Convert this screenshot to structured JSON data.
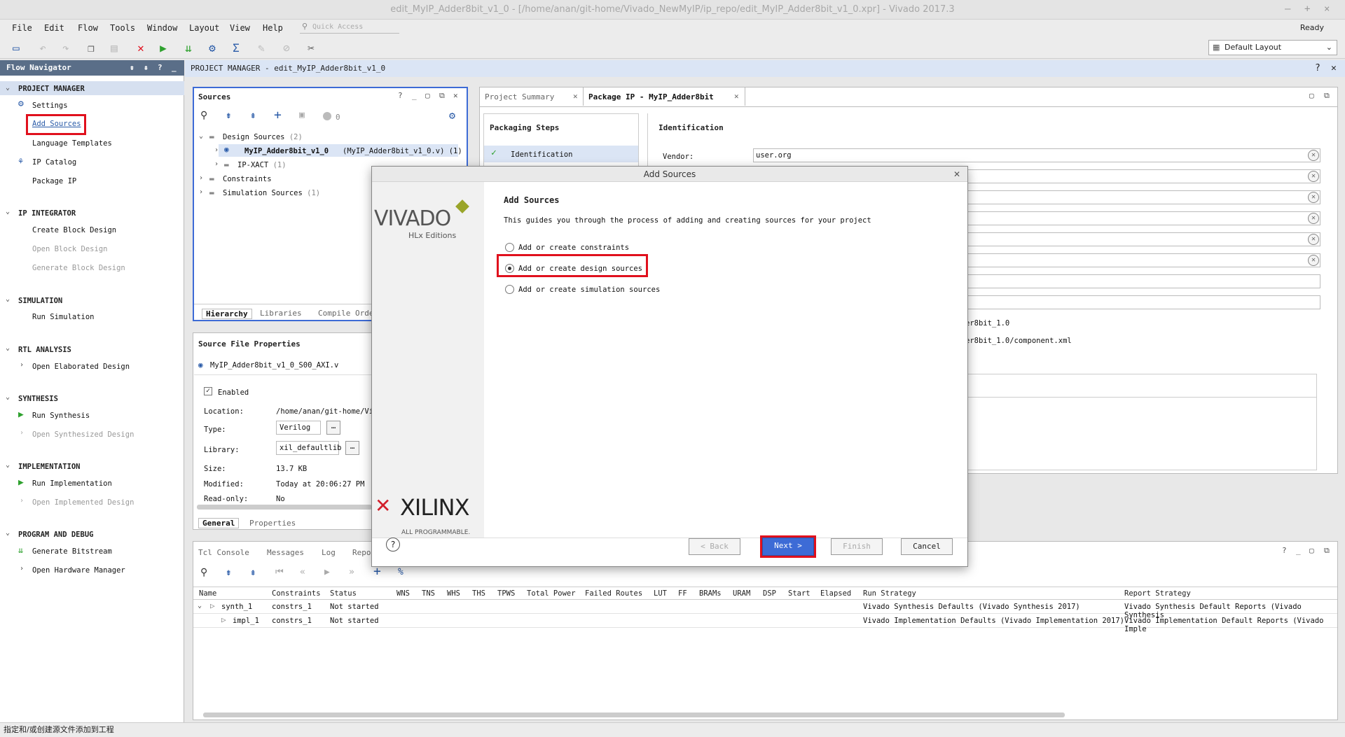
{
  "window": {
    "title": "edit_MyIP_Adder8bit_v1_0 - [/home/anan/git-home/Vivado_NewMyIP/ip_repo/edit_MyIP_Adder8bit_v1_0.xpr] - Vivado 2017.3",
    "status": "Ready"
  },
  "menu": [
    "File",
    "Edit",
    "Flow",
    "Tools",
    "Window",
    "Layout",
    "View",
    "Help"
  ],
  "quick_access_placeholder": "Quick Access",
  "layout_selector": "Default Layout",
  "flow_navigator": {
    "title": "Flow Navigator",
    "sections": {
      "project_manager": "PROJECT MANAGER",
      "settings": "Settings",
      "add_sources": "Add Sources",
      "language_templates": "Language Templates",
      "ip_catalog": "IP Catalog",
      "package_ip": "Package IP",
      "ip_integrator": "IP INTEGRATOR",
      "create_block_design": "Create Block Design",
      "open_block_design": "Open Block Design",
      "generate_block_design": "Generate Block Design",
      "simulation": "SIMULATION",
      "run_simulation": "Run Simulation",
      "rtl_analysis": "RTL ANALYSIS",
      "open_elaborated_design": "Open Elaborated Design",
      "synthesis": "SYNTHESIS",
      "run_synthesis": "Run Synthesis",
      "open_synthesized_design": "Open Synthesized Design",
      "implementation": "IMPLEMENTATION",
      "run_implementation": "Run Implementation",
      "open_implemented_design": "Open Implemented Design",
      "program_and_debug": "PROGRAM AND DEBUG",
      "generate_bitstream": "Generate Bitstream",
      "open_hardware_manager": "Open Hardware Manager"
    }
  },
  "project_manager_header": "PROJECT MANAGER - edit_MyIP_Adder8bit_v1_0",
  "sources": {
    "title": "Sources",
    "count": "0",
    "design_sources": "Design Sources",
    "design_sources_count": "(2)",
    "top_module": "MyIP_Adder8bit_v1_0",
    "top_module_file": "(MyIP_Adder8bit_v1_0.v) (1)",
    "ip_xact": "IP-XACT",
    "ip_xact_count": "(1)",
    "constraints": "Constraints",
    "simulation_sources": "Simulation Sources",
    "simulation_sources_count": "(1)",
    "tabs": [
      "Hierarchy",
      "Libraries",
      "Compile Order"
    ]
  },
  "source_file_properties": {
    "title": "Source File Properties",
    "filename": "MyIP_Adder8bit_v1_0_S00_AXI.v",
    "enabled_label": "Enabled",
    "location_label": "Location:",
    "location_value": "/home/anan/git-home/Viv",
    "type_label": "Type:",
    "type_value": "Verilog",
    "library_label": "Library:",
    "library_value": "xil_defaultlib",
    "size_label": "Size:",
    "size_value": "13.7 KB",
    "modified_label": "Modified:",
    "modified_value": "Today at 20:06:27 PM",
    "readonly_label": "Read-only:",
    "readonly_value": "No",
    "tabs": [
      "General",
      "Properties"
    ]
  },
  "package_ip": {
    "tabs": [
      "Project Summary",
      "Package IP - MyIP_Adder8bit"
    ],
    "packaging_steps_title": "Packaging Steps",
    "step_identification": "Identification",
    "identification_title": "Identification",
    "vendor_label": "Vendor:",
    "vendor_value": "user.org",
    "partial_1": "er8bit_1.0",
    "partial_2": "er8bit_1.0/component.xml"
  },
  "dialog": {
    "title": "Add Sources",
    "heading": "Add Sources",
    "description": "This guides you through the process of adding and creating sources for your project",
    "option_constraints": "Add or create constraints",
    "option_design": "Add or create design sources",
    "option_simulation": "Add or create simulation sources",
    "back": "< Back",
    "next": "Next >",
    "finish": "Finish",
    "cancel": "Cancel",
    "vivado_logo": "VIVADO",
    "vivado_sub": "HLx Editions",
    "xilinx_logo": "XILINX",
    "xilinx_sub": "ALL PROGRAMMABLE."
  },
  "bottom": {
    "tabs": [
      "Tcl Console",
      "Messages",
      "Log",
      "Reports"
    ],
    "columns": [
      "Name",
      "Constraints",
      "Status",
      "WNS",
      "TNS",
      "WHS",
      "THS",
      "TPWS",
      "Total Power",
      "Failed Routes",
      "LUT",
      "FF",
      "BRAMs",
      "URAM",
      "DSP",
      "Start",
      "Elapsed",
      "Run Strategy",
      "Report Strategy"
    ],
    "rows": [
      {
        "name": "synth_1",
        "constraints": "constrs_1",
        "status": "Not started",
        "run_strategy": "Vivado Synthesis Defaults (Vivado Synthesis 2017)",
        "report_strategy": "Vivado Synthesis Default Reports (Vivado Synthesis"
      },
      {
        "name": "impl_1",
        "constraints": "constrs_1",
        "status": "Not started",
        "run_strategy": "Vivado Implementation Defaults (Vivado Implementation 2017)",
        "report_strategy": "Vivado Implementation Default Reports (Vivado Imple"
      }
    ]
  },
  "statusbar": "指定和/或创建源文件添加到工程",
  "colors": {
    "accent_blue": "#3d6bd6",
    "highlight_red": "#e0101d",
    "nav_header": "#5a6e88",
    "run_green": "#2ea12e"
  }
}
